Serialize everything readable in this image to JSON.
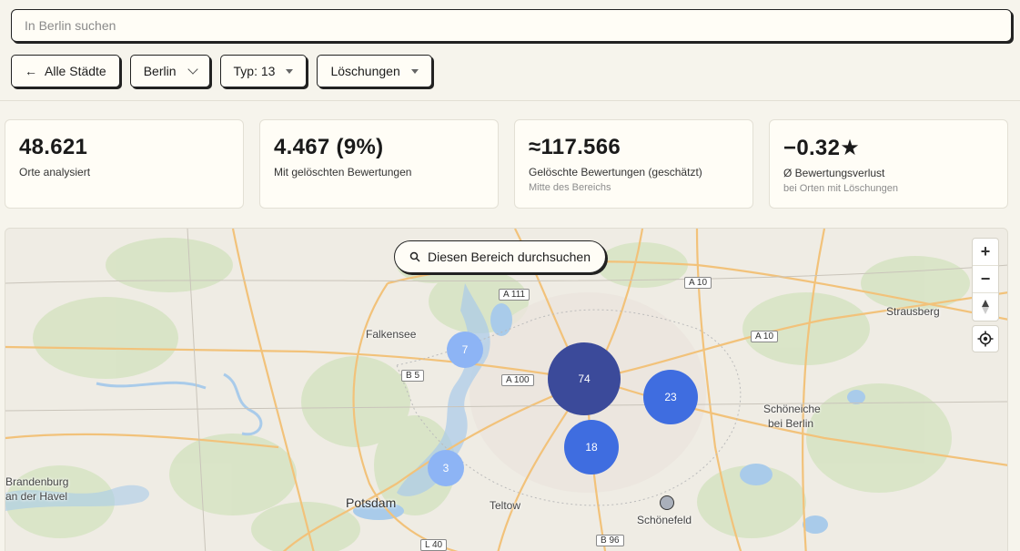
{
  "search": {
    "placeholder": "In Berlin suchen"
  },
  "filters": {
    "back_label": "Alle Städte",
    "city_label": "Berlin",
    "type_label": "Typ: 13",
    "deletions_label": "Löschungen"
  },
  "stats": [
    {
      "value": "48.621",
      "label": "Orte analysiert",
      "sub": ""
    },
    {
      "value": "4.467 (9%)",
      "label": "Mit gelöschten Bewertungen",
      "sub": ""
    },
    {
      "value": "≈117.566",
      "label": "Gelöschte Bewertungen (geschätzt)",
      "sub": "Mitte des Bereichs"
    },
    {
      "value": "−0.32★",
      "label": "Ø Bewertungsverlust",
      "sub": "bei Orten mit Löschungen"
    }
  ],
  "map": {
    "area_search_label": "Diesen Bereich durchsuchen",
    "zoom_in": "+",
    "zoom_out": "−",
    "places": {
      "falkensee": "Falkensee",
      "strausberg": "Strausberg",
      "schoeneiche_1": "Schöneiche",
      "schoeneiche_2": "bei Berlin",
      "brandenburg_1": "Brandenburg",
      "brandenburg_2": "an der Havel",
      "potsdam": "Potsdam",
      "teltow": "Teltow",
      "schoenefeld": "Schönefeld"
    },
    "roads": {
      "a111": "A 111",
      "a10_top": "A 10",
      "a10_mid": "A 10",
      "b5": "B 5",
      "a100": "A 100",
      "l40": "L 40",
      "b96": "B 96"
    },
    "clusters": {
      "c74": "74",
      "c23": "23",
      "c18": "18",
      "c7": "7",
      "c3": "3"
    },
    "colors": {
      "cluster_dark": "#3b4a9a",
      "cluster_mid": "#3f6de0",
      "cluster_light": "#8db4f5"
    }
  }
}
